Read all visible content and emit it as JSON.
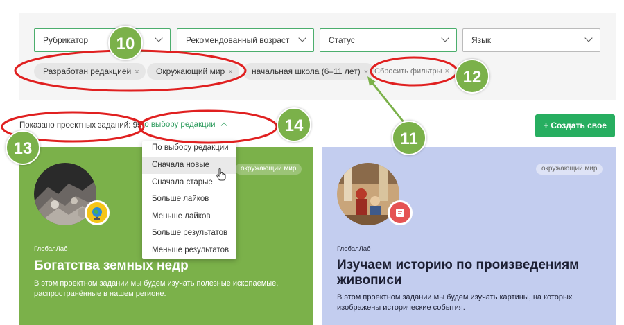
{
  "filters": {
    "selects": [
      {
        "label": "Рубрикатор"
      },
      {
        "label": "Рекомендованный возраст"
      },
      {
        "label": "Статус"
      },
      {
        "label": "Язык"
      }
    ],
    "chips": [
      {
        "label": "Разработан редакцией"
      },
      {
        "label": "Окружающий мир"
      },
      {
        "label": "начальная школа (6–11 лет)"
      }
    ],
    "chip_close": "×",
    "reset_label": "Сбросить фильтры"
  },
  "results": {
    "count_label": "Показано проектных заданий: 95",
    "sort_label": "По выбору редакции"
  },
  "create_button": {
    "icon": "+",
    "label": "Создать свое"
  },
  "sort_menu": {
    "options": [
      "По выбору редакции",
      "Сначала новые",
      "Сначала старые",
      "Больше лайков",
      "Меньше лайков",
      "Больше результатов",
      "Меньше результатов"
    ],
    "hovered": "Сначала новые"
  },
  "cards": [
    {
      "tag": "окружающий мир",
      "author": "ГлобалЛаб",
      "title": "Богатства земных недр",
      "description": "В этом проектном задании мы будем изучать полезные ископаемые, распространённые в нашем регионе.",
      "color": "#7bb14a",
      "badge_icon": "globe-icon"
    },
    {
      "tag": "окружающий мир",
      "author": "ГлобалЛаб",
      "title": "Изучаем историю по произведениям живописи",
      "description": "В этом проектном задании мы будем изучать картины, на которых изображены исторические события.",
      "color": "#c3cdef",
      "badge_icon": "scroll-icon"
    }
  ],
  "annotations": {
    "markers": [
      "10",
      "11",
      "12",
      "13",
      "14"
    ],
    "color": "#e02020",
    "marker_color": "#7bb14a"
  }
}
